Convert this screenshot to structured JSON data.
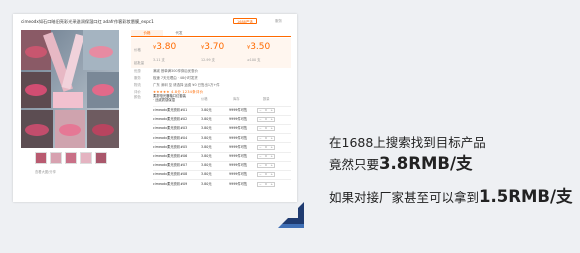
{
  "product": {
    "title": "cimeodx如石口暗旧亮彩光采滋润保湿口红 adafr作客彩妆唇膜_expc1",
    "badge": "1688严选",
    "service": "服务",
    "thumb_hint": "查看大图/分享",
    "tabs": [
      "价格",
      "代发"
    ],
    "price_label": "价格",
    "qty_label": "起批量",
    "prices": [
      {
        "currency": "¥",
        "value": "3.80",
        "qty": "3-11 支"
      },
      {
        "currency": "¥",
        "value": "3.70",
        "qty": "12-99 支"
      },
      {
        "currency": "¥",
        "value": "3.50",
        "qty": "≥100 支"
      }
    ],
    "rows": [
      {
        "label": "优惠",
        "value": "满减 首单满300享券后优惠价"
      },
      {
        "label": "服务",
        "value": "极速 7天无理由 · 48小时发货"
      },
      {
        "label": "物流",
        "value": "广东 深圳 至 请选择    运费 ¥0      已售出1万+件"
      },
      {
        "label": "评价",
        "value": "★★★★★ 4.8分  1234条评价"
      }
    ],
    "sku": {
      "title": "颜色",
      "headers": [
        "",
        "价格",
        "库存",
        "数量"
      ],
      "first_name": "柔雾哑光唇釉口红套装 · 丝绒质感保湿",
      "rows": [
        {
          "name": "cimeodx柔光亮彩#01",
          "price": "3.80元",
          "stock": "9999件可售",
          "qty": "0"
        },
        {
          "name": "cimeodx柔光亮彩#02",
          "price": "3.80元",
          "stock": "9999件可售",
          "qty": "0"
        },
        {
          "name": "cimeodx柔光亮彩#03",
          "price": "3.80元",
          "stock": "9999件可售",
          "qty": "0"
        },
        {
          "name": "cimeodx柔光亮彩#04",
          "price": "3.80元",
          "stock": "9999件可售",
          "qty": "0"
        },
        {
          "name": "cimeodx柔光亮彩#05",
          "price": "3.80元",
          "stock": "9999件可售",
          "qty": "0"
        },
        {
          "name": "cimeodx柔光亮彩#06",
          "price": "3.80元",
          "stock": "9999件可售",
          "qty": "0"
        },
        {
          "name": "cimeodx柔光亮彩#07",
          "price": "3.80元",
          "stock": "9999件可售",
          "qty": "0"
        },
        {
          "name": "cimeodx柔光亮彩#08",
          "price": "3.80元",
          "stock": "9999件可售",
          "qty": "0"
        },
        {
          "name": "cimeodx柔光亮彩#09",
          "price": "3.80元",
          "stock": "9999件可售",
          "qty": "0"
        }
      ]
    }
  },
  "caption": {
    "line1": "在1688上搜索找到目标产品",
    "line2_prefix": "竟然只要",
    "line2_price": "3.8RMB/支",
    "line3_prefix": "如果对接厂家甚至可以拿到",
    "line3_price": "1.5RMB/支"
  },
  "colors": {
    "accent": "#ff6a00",
    "corner_dark": "#1f3b70",
    "corner_light": "#3f6fb5"
  }
}
